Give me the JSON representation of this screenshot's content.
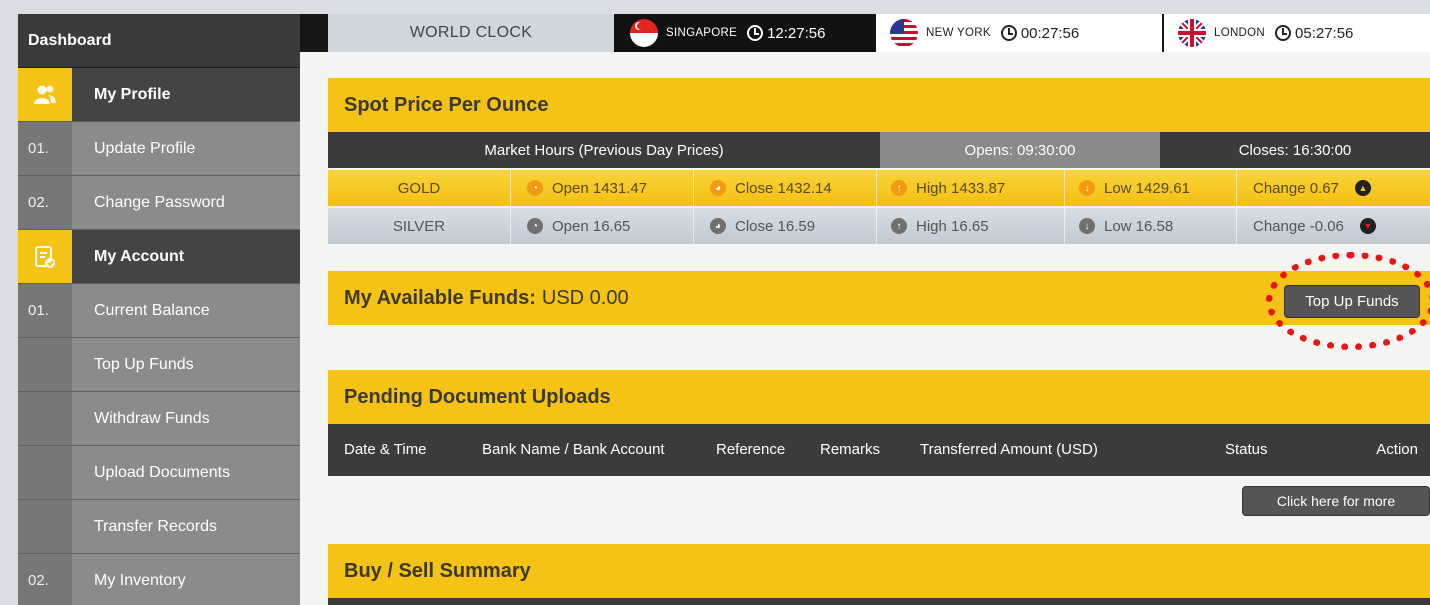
{
  "sidebar": {
    "title": "Dashboard",
    "profile_section": "My Profile",
    "profile_items": [
      {
        "num": "01.",
        "label": "Update Profile"
      },
      {
        "num": "02.",
        "label": "Change Password"
      }
    ],
    "account_section": "My Account",
    "account_items": [
      {
        "num": "01.",
        "label": "Current Balance"
      },
      {
        "num": "",
        "label": "Top Up Funds"
      },
      {
        "num": "",
        "label": "Withdraw Funds"
      },
      {
        "num": "",
        "label": "Upload Documents"
      },
      {
        "num": "",
        "label": "Transfer Records"
      },
      {
        "num": "02.",
        "label": "My Inventory"
      }
    ]
  },
  "clock": {
    "title": "WORLD CLOCK",
    "cities": [
      {
        "name": "SINGAPORE",
        "time": "12:27:56",
        "flag": "singapore-flag"
      },
      {
        "name": "NEW YORK",
        "time": "00:27:56",
        "flag": "usa-flag"
      },
      {
        "name": "LONDON",
        "time": "05:27:56",
        "flag": "uk-flag"
      }
    ]
  },
  "spot": {
    "title": "Spot Price Per Ounce",
    "market_hours": "Market Hours (Previous Day Prices)",
    "opens": "Opens: 09:30:00",
    "closes": "Closes: 16:30:00",
    "gold": {
      "metal": "GOLD",
      "open": "Open 1431.47",
      "close": "Close 1432.14",
      "high": "High 1433.87",
      "low": "Low 1429.61",
      "change": "Change 0.67"
    },
    "silver": {
      "metal": "SILVER",
      "open": "Open 16.65",
      "close": "Close 16.59",
      "high": "High 16.65",
      "low": "Low 16.58",
      "change": "Change -0.06"
    }
  },
  "funds": {
    "label": "My Available Funds:",
    "value": "USD 0.00",
    "topup_button": "Top Up Funds"
  },
  "pending": {
    "title": "Pending Document Uploads",
    "columns": [
      "Date & Time",
      "Bank Name / Bank Account",
      "Reference",
      "Remarks",
      "Transferred Amount (USD)",
      "Status",
      "Action"
    ],
    "more_button": "Click here for more"
  },
  "summary": {
    "title": "Buy / Sell Summary"
  },
  "colors": {
    "accent": "#f5c216",
    "dark": "#3b3b3b",
    "highlight": "#e81717"
  }
}
